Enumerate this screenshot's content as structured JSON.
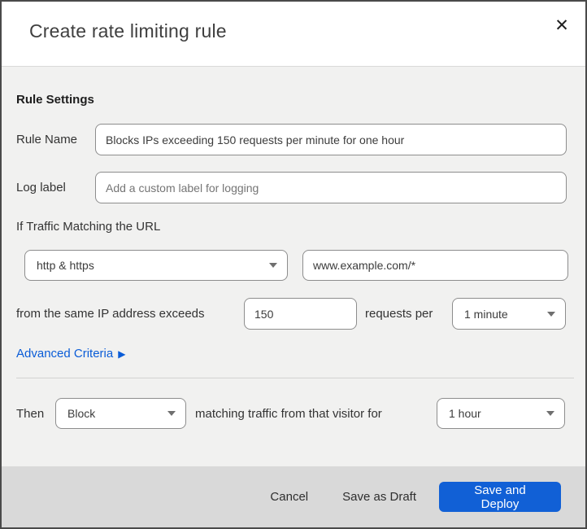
{
  "dialog": {
    "title": "Create rate limiting rule",
    "close_icon": "close"
  },
  "section": {
    "heading": "Rule Settings"
  },
  "fields": {
    "rule_name": {
      "label": "Rule Name",
      "value": "Blocks IPs exceeding 150 requests per minute for one hour"
    },
    "log_label": {
      "label": "Log label",
      "placeholder": "Add a custom label for logging"
    }
  },
  "match": {
    "intro": "If Traffic Matching the URL",
    "scheme_select": {
      "value": "http & https"
    },
    "url_input": {
      "value": "www.example.com/*"
    },
    "threshold_text_before": "from the same IP address exceeds",
    "threshold_value": "150",
    "threshold_text_after": "requests per",
    "period_select": {
      "value": "1 minute"
    },
    "advanced_link": "Advanced Criteria",
    "advanced_arrow": "▶"
  },
  "action": {
    "then_label": "Then",
    "action_select": {
      "value": "Block"
    },
    "middle_text": "matching traffic from that visitor for",
    "duration_select": {
      "value": "1 hour"
    }
  },
  "footer": {
    "cancel": "Cancel",
    "save_draft": "Save as Draft",
    "save_deploy": "Save and Deploy"
  },
  "colors": {
    "primary_blue": "#1160d6",
    "link_blue": "#0a5cd7",
    "footer_gray": "#d9d9d9",
    "body_gray": "#f1f1f0",
    "topbar_navy": "#102433"
  },
  "close_glyph": "✕"
}
